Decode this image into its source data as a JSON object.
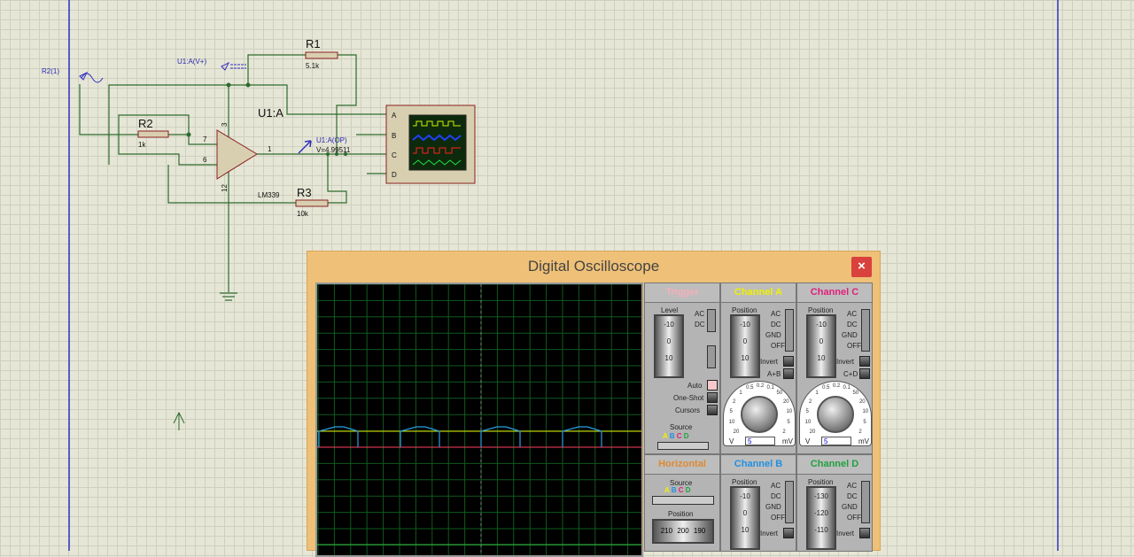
{
  "schematic": {
    "labels": {
      "r1": "R1",
      "r1_val": "5.1k",
      "r2": "R2",
      "r2_val": "1k",
      "r3": "R3",
      "r3_val": "10k",
      "u1": "U1:A",
      "u1_part": "LM339",
      "probe_vplus": "U1:A(V+)",
      "probe_r2": "R2(1)",
      "probe_op": "U1:A(OP)",
      "probe_op_value": "V=4.99511",
      "pin3": "3",
      "pin7": "7",
      "pin6": "6",
      "pin1": "1",
      "pin12": "12",
      "scope_a": "A",
      "scope_b": "B",
      "scope_c": "C",
      "scope_d": "D"
    }
  },
  "oscilloscope": {
    "title": "Digital Oscilloscope",
    "close": "×",
    "trigger": {
      "header": "Trigger",
      "level": "Level",
      "ac": "AC",
      "dc": "DC",
      "ticks": [
        "-10",
        "0",
        "10"
      ],
      "auto": "Auto",
      "one_shot": "One-Shot",
      "cursors": "Cursors",
      "source": "Source",
      "sources": [
        "A",
        "B",
        "C",
        "D"
      ]
    },
    "channel_a": {
      "header": "Channel A",
      "color": "#f0f000",
      "position": "Position",
      "ticks": [
        "-10",
        "0",
        "10"
      ],
      "coupling": [
        "AC",
        "DC",
        "GND",
        "OFF"
      ],
      "invert": "Invert",
      "combine": "A+B",
      "value": "5",
      "v": "V",
      "mv": "mV"
    },
    "channel_c": {
      "header": "Channel C",
      "color": "#e0207a",
      "position": "Position",
      "ticks": [
        "-10",
        "0",
        "10"
      ],
      "coupling": [
        "AC",
        "DC",
        "GND",
        "OFF"
      ],
      "invert": "Invert",
      "combine": "C+D",
      "value": "5",
      "v": "V",
      "mv": "mV"
    },
    "horizontal": {
      "header": "Horizontal",
      "color": "#e08a30",
      "source": "Source",
      "sources": [
        "A",
        "B",
        "C",
        "D"
      ],
      "position": "Position",
      "ticks": [
        "210",
        "200",
        "190"
      ]
    },
    "channel_b": {
      "header": "Channel B",
      "color": "#2090e0",
      "position": "Position",
      "ticks": [
        "-10",
        "0",
        "10"
      ],
      "coupling": [
        "AC",
        "DC",
        "GND",
        "OFF"
      ],
      "invert": "Invert"
    },
    "channel_d": {
      "header": "Channel D",
      "color": "#20a040",
      "position": "Position",
      "ticks": [
        "-130",
        "-120",
        "-110"
      ],
      "coupling": [
        "AC",
        "DC",
        "GND",
        "OFF"
      ],
      "invert": "Invert"
    },
    "knob_scale": [
      "20",
      "10",
      "5",
      "2",
      "1",
      "0.5",
      "0.2",
      "0.1",
      "50",
      "20",
      "10",
      "5",
      "2"
    ],
    "trace_colors": {
      "a": "#e8e800",
      "b": "#2aa0e0",
      "c": "#ff4060",
      "d": "#30c040"
    }
  }
}
